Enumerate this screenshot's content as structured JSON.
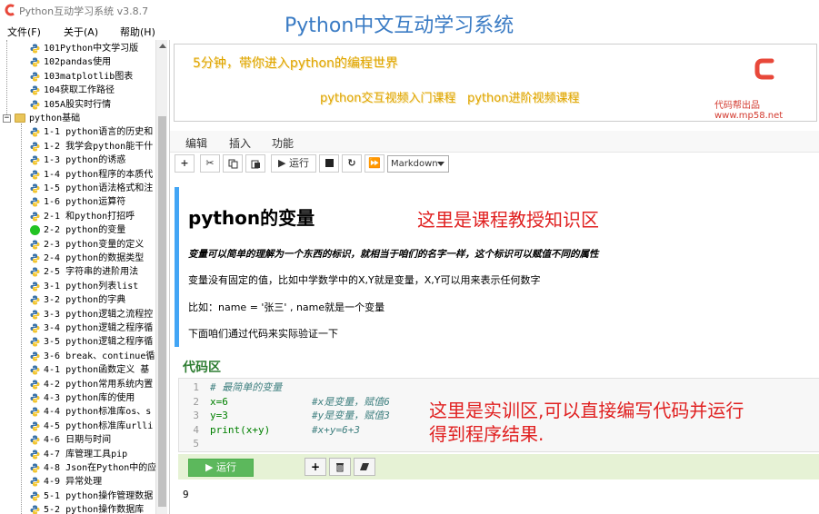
{
  "window": {
    "title": "Python互动学习系统 v3.8.7",
    "logo_color": "#e8483a",
    "banner_title": "Python中文互动学习系统"
  },
  "menubar": {
    "file": "文件(F)",
    "about": "关于(A)",
    "help": "帮助(H)"
  },
  "sidebar": {
    "items": [
      {
        "label": "101Python中文学习版",
        "kind": "python"
      },
      {
        "label": "102pandas使用",
        "kind": "python"
      },
      {
        "label": "103matplotlib图表",
        "kind": "python"
      },
      {
        "label": "104获取工作路径",
        "kind": "python"
      },
      {
        "label": "105A股实时行情",
        "kind": "python"
      },
      {
        "label": "python基础",
        "kind": "folder"
      },
      {
        "label": "1-1 python语言的历史和",
        "kind": "python"
      },
      {
        "label": "1-2 我学会python能干什",
        "kind": "python"
      },
      {
        "label": "1-3 python的诱惑",
        "kind": "python"
      },
      {
        "label": "1-4 python程序的本质代",
        "kind": "python"
      },
      {
        "label": "1-5 python语法格式和注",
        "kind": "python"
      },
      {
        "label": "1-6 python运算符",
        "kind": "python"
      },
      {
        "label": "2-1 和python打招呼",
        "kind": "python"
      },
      {
        "label": "2-2 python的变量",
        "kind": "current"
      },
      {
        "label": "2-3 python变量的定义",
        "kind": "python"
      },
      {
        "label": "2-4 python的数据类型",
        "kind": "python"
      },
      {
        "label": "2-5 字符串的进阶用法",
        "kind": "python"
      },
      {
        "label": "3-1 python列表list",
        "kind": "python"
      },
      {
        "label": "3-2 python的字典",
        "kind": "python"
      },
      {
        "label": "3-3 python逻辑之流程控",
        "kind": "python"
      },
      {
        "label": "3-4 python逻辑之程序循",
        "kind": "python"
      },
      {
        "label": "3-5 python逻辑之程序循",
        "kind": "python"
      },
      {
        "label": "3-6 break、continue循",
        "kind": "python"
      },
      {
        "label": "4-1 python函数定义 基",
        "kind": "python"
      },
      {
        "label": "4-2 python常用系统内置",
        "kind": "python"
      },
      {
        "label": "4-3 python库的使用",
        "kind": "python"
      },
      {
        "label": "4-4 python标准库os、s",
        "kind": "python"
      },
      {
        "label": "4-5 python标准库urlli",
        "kind": "python"
      },
      {
        "label": "4-6 日期与时间",
        "kind": "python"
      },
      {
        "label": "4-7 库管理工具pip",
        "kind": "python"
      },
      {
        "label": "4-8 Json在Python中的应",
        "kind": "python"
      },
      {
        "label": "4-9 异常处理",
        "kind": "python"
      },
      {
        "label": "5-1 python操作管理数据",
        "kind": "python"
      },
      {
        "label": "5-2 python操作数据库",
        "kind": "python"
      }
    ]
  },
  "banner": {
    "line1": "5分钟，带你进入python的编程世界",
    "line2": "python交互视频入门课程",
    "line3": "python进阶视频课程",
    "site": "代码帮出品 www.mp58.net"
  },
  "notebook_menu": {
    "edit": "编辑",
    "insert": "插入",
    "function": "功能"
  },
  "toolbar": {
    "add_icon": "plus-icon",
    "cut_icon": "scissors-icon",
    "copy_icon": "copy-icon",
    "paste_icon": "paste-icon",
    "run_label": "▶ 运行",
    "stop_icon": "stop-icon",
    "restart_icon": "restart-icon",
    "fast_forward_icon": "fast-forward-icon",
    "cell_type": "Markdown"
  },
  "markdown": {
    "title": "python的变量",
    "annotation": "这里是课程教授知识区",
    "bold_line": "变量可以简单的理解为一个东西的标识，就相当于咱们的名字一样，这个标识可以赋值不同的属性",
    "p1": "变量没有固定的值，比如中学数学中的X,Y就是变量，X,Y可以用来表示任何数字",
    "p2": "比如：name = '张三' , name就是一个变量",
    "p3": "下面咱们通过代码来实际验证一下",
    "accent_color": "#42a5f5"
  },
  "code": {
    "heading": "代码区",
    "lines": [
      {
        "num": "1",
        "code": "# 最简单的变量",
        "comment": ""
      },
      {
        "num": "2",
        "code": "x=6",
        "comment": "#x是变量，赋值6"
      },
      {
        "num": "3",
        "code": "y=3",
        "comment": "#y是变量，赋值3"
      },
      {
        "num": "4",
        "code": "print(x+y)",
        "comment": "#x+y=6+3"
      },
      {
        "num": "5",
        "code": "",
        "comment": ""
      }
    ],
    "annotation_line1": "这里是实训区,可以直接编写代码并运行",
    "annotation_line2": "得到程序结果.",
    "run_label": "▶ 运行",
    "add_icon": "plus-icon",
    "delete_icon": "trash-icon",
    "clear_icon": "eraser-icon",
    "output": "9",
    "run_color": "#5cb85c"
  }
}
